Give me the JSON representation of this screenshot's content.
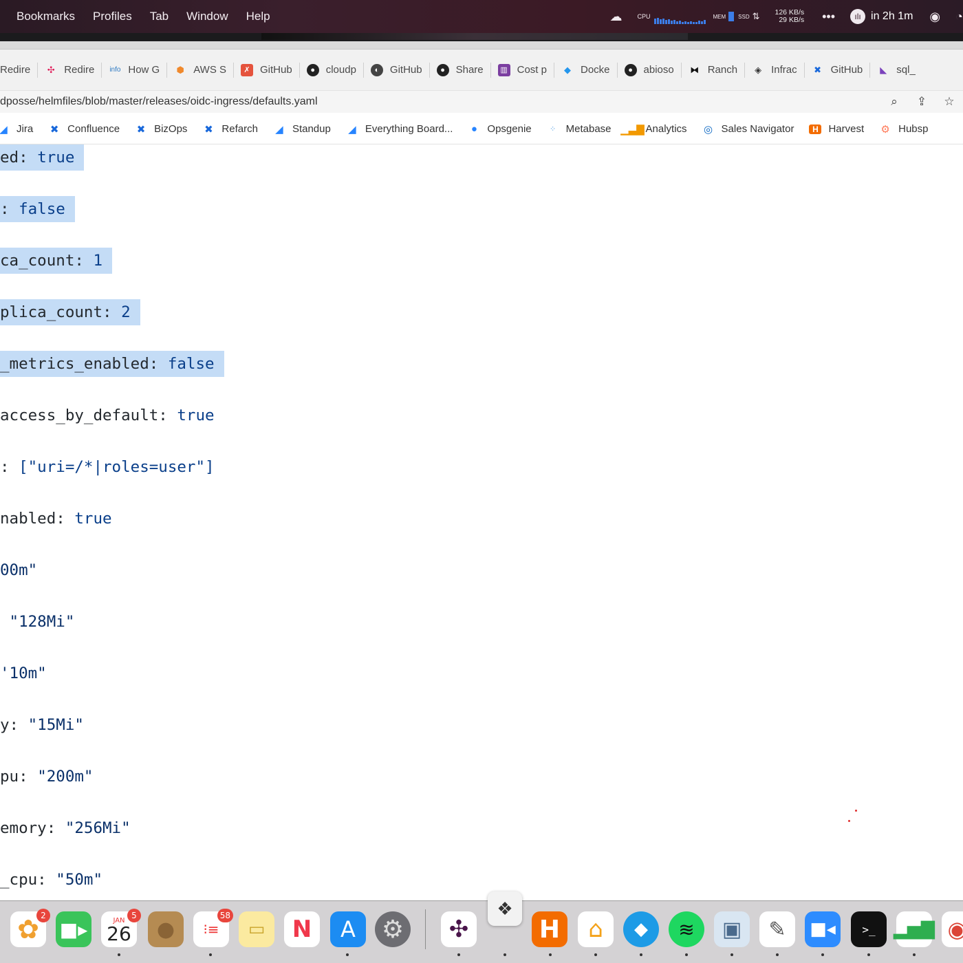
{
  "menubar": {
    "items": [
      "Bookmarks",
      "Profiles",
      "Tab",
      "Window",
      "Help"
    ],
    "net_up": "126 KB/s",
    "net_down": "29 KB/s",
    "cpu_label": "CPU",
    "mem_label": "MEM",
    "ssd_label": "SSD",
    "timer": "in 2h 1m"
  },
  "bookmarks_bar_top": [
    {
      "label": "Redire",
      "icon": "redirect-icon"
    },
    {
      "label": "Redire",
      "icon": "slack-icon"
    },
    {
      "label": "How G",
      "icon": "info-icon"
    },
    {
      "label": "AWS S",
      "icon": "aws-icon"
    },
    {
      "label": "GitHub",
      "icon": "github-actions-icon"
    },
    {
      "label": "cloudp",
      "icon": "github-icon"
    },
    {
      "label": "GitHub",
      "icon": "globe-icon"
    },
    {
      "label": "Share",
      "icon": "github-icon"
    },
    {
      "label": "Cost p",
      "icon": "chart-icon"
    },
    {
      "label": "Docke",
      "icon": "docker-icon"
    },
    {
      "label": "abioso",
      "icon": "github-icon"
    },
    {
      "label": "Ranch",
      "icon": "rancher-icon"
    },
    {
      "label": "Infrac",
      "icon": "infracost-icon"
    },
    {
      "label": "GitHub",
      "icon": "confluence-icon"
    },
    {
      "label": "sql_",
      "icon": "terraform-icon"
    }
  ],
  "address": {
    "url": "dposse/helmfiles/blob/master/releases/oidc-ingress/defaults.yaml"
  },
  "bookmarks_bar": [
    {
      "label": "Jira",
      "icon": "jira-icon"
    },
    {
      "label": "Confluence",
      "icon": "confluence-icon"
    },
    {
      "label": "BizOps",
      "icon": "confluence-icon"
    },
    {
      "label": "Refarch",
      "icon": "confluence-icon"
    },
    {
      "label": "Standup",
      "icon": "jira-icon"
    },
    {
      "label": "Everything Board...",
      "icon": "jira-icon"
    },
    {
      "label": "Opsgenie",
      "icon": "opsgenie-icon"
    },
    {
      "label": "Metabase",
      "icon": "metabase-icon"
    },
    {
      "label": "Analytics",
      "icon": "analytics-icon"
    },
    {
      "label": "Sales Navigator",
      "icon": "compass-icon"
    },
    {
      "label": "Harvest",
      "icon": "harvest-icon"
    },
    {
      "label": "Hubsp",
      "icon": "hubspot-icon"
    }
  ],
  "code_lines": [
    {
      "key": "ed: ",
      "value": "true",
      "selected": true
    },
    {
      "key": ": ",
      "value": "false",
      "selected": true
    },
    {
      "key": "ca_count: ",
      "value": "1",
      "selected": true
    },
    {
      "key": "plica_count: ",
      "value": "2",
      "selected": true
    },
    {
      "key": "_metrics_enabled: ",
      "value": "false",
      "selected": true
    },
    {
      "key": "access_by_default: ",
      "value": "true",
      "selected": false
    },
    {
      "key": ": ",
      "value": "[\"uri=/*|roles=user\"]",
      "selected": false
    },
    {
      "key": "nabled: ",
      "value": "true",
      "selected": false
    },
    {
      "key": "",
      "value": "00m\"",
      "selected": false
    },
    {
      "key": " ",
      "value": "\"128Mi\"",
      "selected": false
    },
    {
      "key": "",
      "value": "'10m\"",
      "selected": false
    },
    {
      "key": "y: ",
      "value": "\"15Mi\"",
      "selected": false
    },
    {
      "key": "pu: ",
      "value": "\"200m\"",
      "selected": false
    },
    {
      "key": "emory: ",
      "value": "\"256Mi\"",
      "selected": false
    },
    {
      "key": "_cpu: ",
      "value": "\"50m\"",
      "selected": false
    }
  ],
  "dock": {
    "photos_badge": "2",
    "calendar_month": "JAN",
    "calendar_day": "26",
    "calendar_badge": "5",
    "reminders_badge": "58"
  },
  "colors": {
    "selection": "#c4dcf6",
    "value": "#0a3f8a",
    "menubar": "#3a1f2c"
  }
}
